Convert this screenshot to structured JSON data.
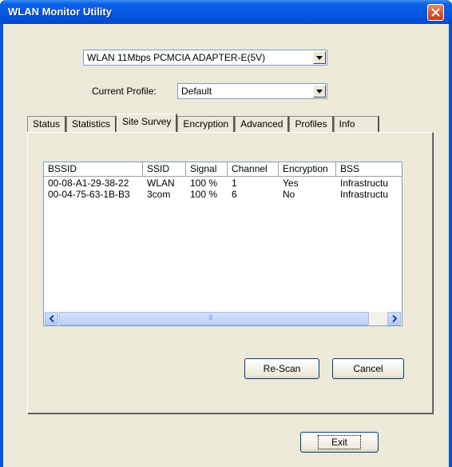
{
  "window": {
    "title": "WLAN Monitor Utility"
  },
  "adapter": {
    "selected": "WLAN 11Mbps PCMCIA ADAPTER-E(5V)"
  },
  "profile": {
    "label": "Current Profile:",
    "selected": "Default"
  },
  "tabs": [
    {
      "label": "Status"
    },
    {
      "label": "Statistics"
    },
    {
      "label": "Site Survey",
      "active": true
    },
    {
      "label": "Encryption"
    },
    {
      "label": "Advanced"
    },
    {
      "label": "Profiles"
    },
    {
      "label": "Info"
    }
  ],
  "survey": {
    "columns": [
      "BSSID",
      "SSID",
      "Signal",
      "Channel",
      "Encryption",
      "BSS"
    ],
    "rows": [
      [
        "00-08-A1-29-38-22",
        "WLAN",
        "100 %",
        "1",
        "Yes",
        "Infrastructu"
      ],
      [
        "00-04-75-63-1B-B3",
        "3com",
        "100 %",
        "6",
        "No",
        "Infrastructu"
      ]
    ],
    "scroll_grip": "III",
    "rescan_label": "Re-Scan",
    "cancel_label": "Cancel"
  },
  "footer": {
    "exit_label": "Exit"
  },
  "colors": {
    "titlebar": "#0657e2",
    "face": "#ece9d8",
    "close": "#d4552f"
  }
}
